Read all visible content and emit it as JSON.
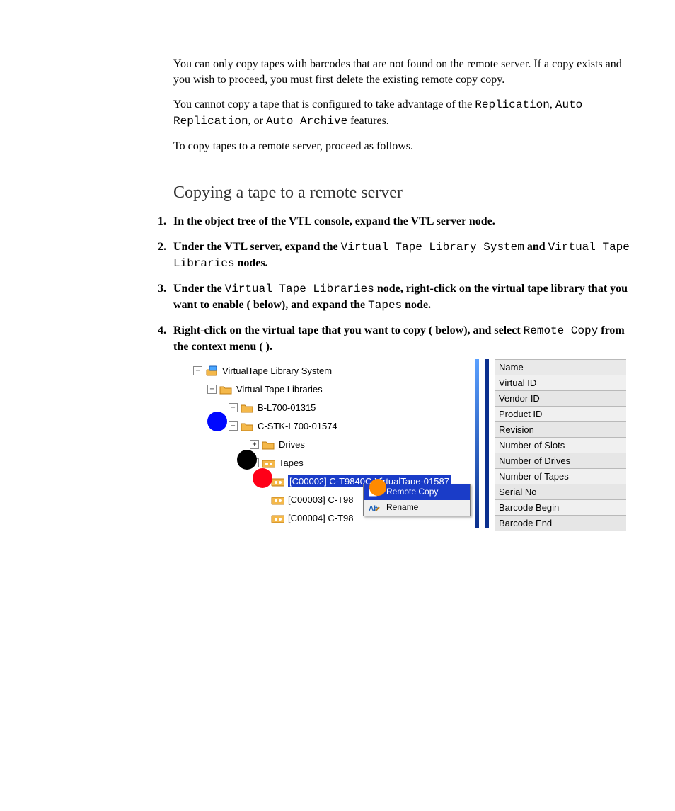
{
  "intro": {
    "p1": "You can only copy tapes with barcodes that are not found on the remote server. If a copy exists and you wish to proceed, you must first delete the existing remote copy copy.",
    "p2_pre": "You cannot copy a tape that is configured to take advantage of the ",
    "p2_m1": "Replication",
    "p2_mid1": ", ",
    "p2_m2": "Auto Replication",
    "p2_mid2": ", or ",
    "p2_m3": "Auto Archive",
    "p2_post": " features.",
    "p3": "To copy tapes to a remote server, proceed as follows."
  },
  "heading": "Copying a tape to a remote server",
  "steps": {
    "s1": "In the object tree of the VTL console, expand the VTL server node.",
    "s2_pre": "Under the VTL server, expand the ",
    "s2_m1": "Virtual Tape Library System",
    "s2_mid": " and ",
    "s2_m2": "Virtual Tape Libraries",
    "s2_post": " nodes.",
    "s3_pre": "Under the ",
    "s3_m1": "Virtual Tape Libraries",
    "s3_mid1": " node, right-click on the virtual tape library that you want to enable (   below), and expand the ",
    "s3_m2": "Tapes",
    "s3_post": " node.",
    "s4_pre": "Right-click on the virtual tape that you want to copy (   below), and select ",
    "s4_m1": "Remote Copy",
    "s4_post": " from the context menu (  )."
  },
  "tree": {
    "n0": "VirtualTape Library System",
    "n1": "Virtual Tape Libraries",
    "n2": "B-L700-01315",
    "n3": "C-STK-L700-01574",
    "n4": "Drives",
    "n5": "Tapes",
    "n6": "[C00002] C-T9840C-VirtualTape-01587",
    "n7": "[C00003] C-T98",
    "n8": "[C00004] C-T98"
  },
  "ctx": {
    "remote_copy": "Remote Copy",
    "rename": "Rename"
  },
  "props": {
    "r0": "Name",
    "r1": "Virtual ID",
    "r2": "Vendor ID",
    "r3": "Product ID",
    "r4": "Revision",
    "r5": "Number of Slots",
    "r6": "Number of Drives",
    "r7": "Number of Tapes",
    "r8": "Serial No",
    "r9": "Barcode Begin",
    "r10": "Barcode End"
  },
  "glyphs": {
    "minus": "−",
    "plus": "+"
  }
}
